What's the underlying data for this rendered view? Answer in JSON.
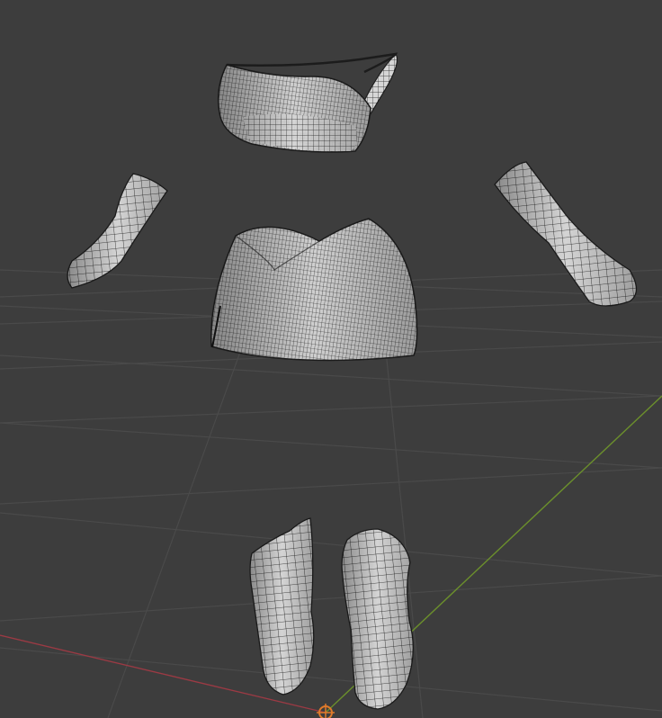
{
  "viewport": {
    "background": "#3d3d3d",
    "grid_color": "#4a4a4a",
    "x_axis_color": "#9b3a44",
    "y_axis_color": "#6b8f2c",
    "origin_color": "#e07a2a"
  },
  "mesh": {
    "fill": "#d9d9d9",
    "shade": "#a8a8a8",
    "wire": "#1c1c1c",
    "objects": [
      "top",
      "left-sleeve",
      "right-sleeve",
      "skirt",
      "left-boot",
      "right-boot"
    ]
  }
}
